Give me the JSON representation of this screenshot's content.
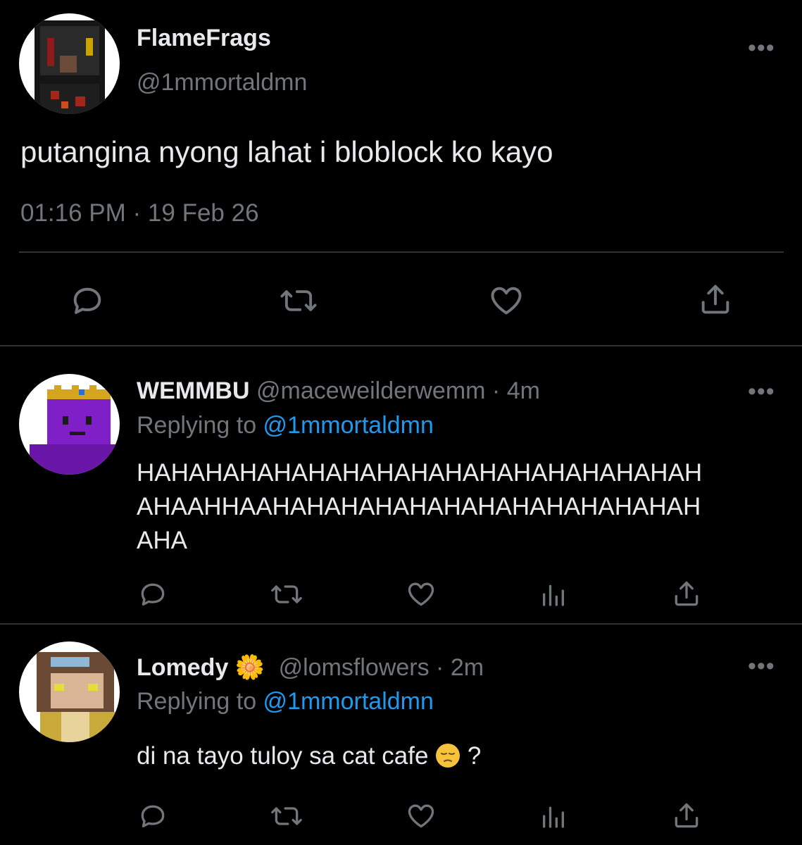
{
  "main_tweet": {
    "display_name": "FlameFrags",
    "handle": "@1mmortaldmn",
    "text": "putangina nyong lahat i bloblock ko kayo",
    "timestamp": "01:16 PM · 19 Feb 26",
    "more_label": "•••"
  },
  "replies": [
    {
      "display_name": "WEMMBU",
      "handle": "@maceweilderwemm",
      "separator": " · ",
      "time": "4m",
      "replying_prefix": "Replying to ",
      "replying_to": "@1mmortaldmn",
      "text_lines": [
        "HAHAHAHAHAHAHAHAHAHAHAHAHAHAHAHAH",
        "AHAAHHAAHAHAHAHAHAHAHAHAHAHAHAHAH",
        "AHA"
      ],
      "more_label": "•••"
    },
    {
      "display_name": "Lomedy",
      "emoji": "🌼",
      "handle": "@lomsflowers",
      "separator": " · ",
      "time": "2m",
      "replying_prefix": "Replying to ",
      "replying_to": "@1mmortaldmn",
      "text_before": "di na tayo tuloy sa cat cafe ",
      "text_after": " ?",
      "more_label": "•••"
    }
  ],
  "colors": {
    "background": "#000000",
    "text": "#e7e9ea",
    "secondary": "#71767b",
    "link": "#1d9bf0",
    "divider": "#2f3336"
  },
  "icons": [
    "reply-icon",
    "retweet-icon",
    "like-icon",
    "analytics-icon",
    "share-icon",
    "more-icon"
  ]
}
